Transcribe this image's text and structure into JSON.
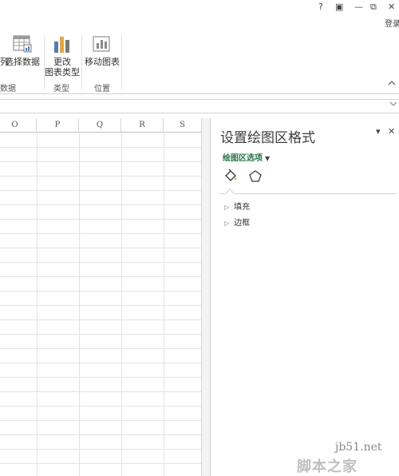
{
  "title_bar": {
    "help_label": "?",
    "restore_ribbon_label": "▣",
    "minimize_label": "—",
    "maximize_label": "⧉",
    "close_label": "✕",
    "login_label": "登录"
  },
  "ribbon": {
    "buttons": {
      "partial_left": "列",
      "select_data": "选择数据",
      "change_type_line1": "更改",
      "change_type_line2": "图表类型",
      "move_chart": "移动图表"
    },
    "groups": {
      "data_partial": "数据",
      "type": "类型",
      "location": "位置"
    },
    "collapse_icon": "chevron-up-icon"
  },
  "formula_bar": {
    "expand_icon": "chevron-down-icon"
  },
  "grid": {
    "columns": [
      "O",
      "P",
      "Q",
      "R",
      "S"
    ]
  },
  "task_pane": {
    "title": "设置绘图区格式",
    "options_label": "绘图区选项",
    "options_arrow": "▼",
    "pin_label": "▾",
    "close_label": "✕",
    "icons": [
      "fill-line-icon",
      "effects-pentagon-icon"
    ],
    "sections": [
      {
        "label": "填充",
        "expanded": false
      },
      {
        "label": "边框",
        "expanded": false
      }
    ]
  },
  "watermark": {
    "url": "jb51.net",
    "name": "脚本之家"
  },
  "colors": {
    "accent_green": "#217346",
    "grid_line": "#e2e2e2",
    "border": "#d4d4d4"
  }
}
